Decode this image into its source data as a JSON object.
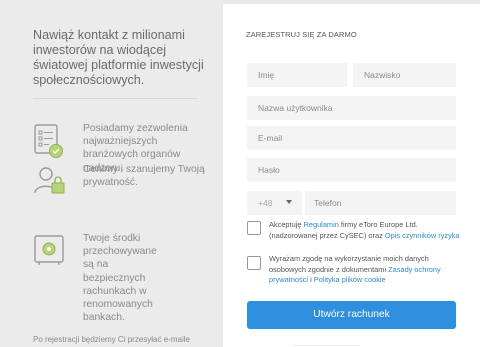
{
  "left": {
    "headline": "Nawiąż kontakt z milionami inwestorów na wiodącej światowej platformie inwestycji społecznościowych.",
    "features": [
      {
        "icon": "licensed-checklist-icon",
        "text": "Posiadamy zezwolenia najważniejszych branżowych organów nadzoru."
      },
      {
        "icon": "user-lock-icon",
        "text": "Cenimy i szanujemy Twoją prywatność."
      },
      {
        "icon": "safe-vault-icon",
        "text": "Twoje środki przechowywane są na bezpiecznych rachunkach w renomowanych bankach."
      }
    ],
    "bottom_note": "Po rejestracji będziemy Ci przesyłać e-maile"
  },
  "form": {
    "title": "ZAREJESTRUJ SIĘ ZA DARMO",
    "first_name_placeholder": "Imię",
    "last_name_placeholder": "Nazwisko",
    "username_placeholder": "Nazwa użytkownika",
    "email_placeholder": "E-mail",
    "password_placeholder": "Hasło",
    "country_code": "+48",
    "phone_placeholder": "Telefon",
    "terms": {
      "pre": "Akceptuję ",
      "link1": "Regulamin",
      "mid": " firmy eToro Europe Ltd. (nadzorowanej przez CySEC) oraz ",
      "link2": "Opis czynników ryzyka"
    },
    "consent": {
      "pre": "Wyrażam zgodę na wykorzystanie moich danych osobowych zgodnie z dokumentami ",
      "link1": "Zasady ochrony prywatności",
      "mid": " i ",
      "link2": "Polityka plików cookie"
    },
    "submit_label": "Utwórz rachunek",
    "footnote": "........................................"
  },
  "colors": {
    "accent": "#2d8fde",
    "link": "#2d8ad3",
    "left_bg": "#ebebeb",
    "card_bg": "#ffffff"
  }
}
